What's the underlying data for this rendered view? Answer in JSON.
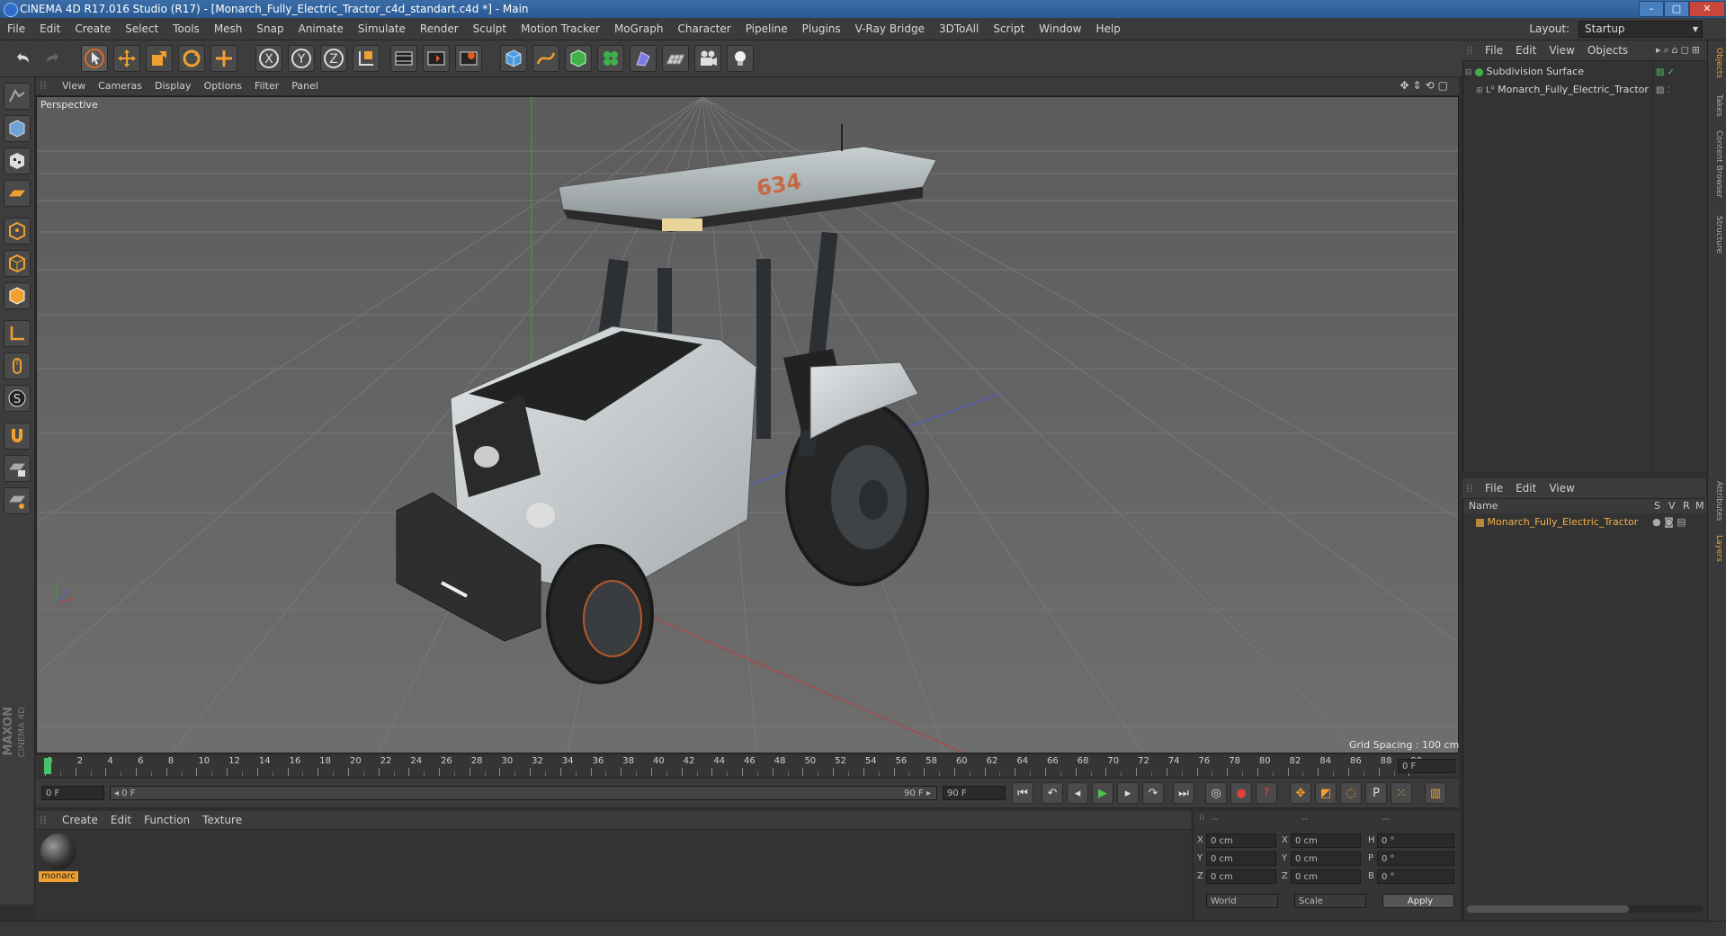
{
  "window": {
    "title": "CINEMA 4D R17.016 Studio (R17) - [Monarch_Fully_Electric_Tractor_c4d_standart.c4d *] - Main",
    "minimize": "–",
    "maximize": "□",
    "close": "✕"
  },
  "menubar": {
    "items": [
      "File",
      "Edit",
      "Create",
      "Select",
      "Tools",
      "Mesh",
      "Snap",
      "Animate",
      "Simulate",
      "Render",
      "Sculpt",
      "Motion Tracker",
      "MoGraph",
      "Character",
      "Pipeline",
      "Plugins",
      "V-Ray Bridge",
      "3DToAll",
      "Script",
      "Window",
      "Help"
    ],
    "layout_label": "Layout:",
    "layout_value": "Startup"
  },
  "viewport": {
    "menu": [
      "View",
      "Cameras",
      "Display",
      "Options",
      "Filter",
      "Panel"
    ],
    "camera_label": "Perspective",
    "grid_spacing": "Grid Spacing : 100 cm",
    "model_decal": "634"
  },
  "timeline": {
    "ticks": [
      "0",
      "2",
      "4",
      "6",
      "8",
      "10",
      "12",
      "14",
      "16",
      "18",
      "20",
      "22",
      "24",
      "26",
      "28",
      "30",
      "32",
      "34",
      "36",
      "38",
      "40",
      "42",
      "44",
      "46",
      "48",
      "50",
      "52",
      "54",
      "56",
      "58",
      "60",
      "62",
      "64",
      "66",
      "68",
      "70",
      "72",
      "74",
      "76",
      "78",
      "80",
      "82",
      "84",
      "86",
      "88",
      "90"
    ],
    "current_frame_field": "0 F",
    "start_field": "0 F",
    "range_start": "◂ 0 F",
    "range_end": "90 F ▸",
    "end_field": "90 F"
  },
  "materials": {
    "menu": [
      "Create",
      "Edit",
      "Function",
      "Texture"
    ],
    "items": [
      {
        "name": "monarc"
      }
    ]
  },
  "coordinates": {
    "header": [
      "--",
      "--",
      "--"
    ],
    "rows": [
      {
        "a": "X",
        "av": "0 cm",
        "b": "X",
        "bv": "0 cm",
        "c": "H",
        "cv": "0 °"
      },
      {
        "a": "Y",
        "av": "0 cm",
        "b": "Y",
        "bv": "0 cm",
        "c": "P",
        "cv": "0 °"
      },
      {
        "a": "Z",
        "av": "0 cm",
        "b": "Z",
        "bv": "0 cm",
        "c": "B",
        "cv": "0 °"
      }
    ],
    "mode_world": "World",
    "mode_scale": "Scale",
    "apply": "Apply"
  },
  "objects": {
    "menu": [
      "File",
      "Edit",
      "View",
      "Objects"
    ],
    "tree": [
      {
        "name": "Subdivision Surface",
        "level": 0
      },
      {
        "name": "Monarch_Fully_Electric_Tractor",
        "level": 1
      }
    ]
  },
  "layers": {
    "menu": [
      "File",
      "Edit",
      "View"
    ],
    "columns": {
      "name": "Name",
      "s": "S",
      "v": "V",
      "r": "R",
      "m": "M"
    },
    "rows": [
      {
        "name": "Monarch_Fully_Electric_Tractor"
      }
    ]
  },
  "right_tabs": [
    "Objects",
    "Takes",
    "Content Browser",
    "Structure",
    "Attributes",
    "Layers"
  ],
  "branding": {
    "maxon": "MAXON",
    "cinema": "CINEMA 4D"
  },
  "colors": {
    "accent": "#f0a030",
    "selected_text": "#f5b14a",
    "green": "#4ec24e"
  }
}
